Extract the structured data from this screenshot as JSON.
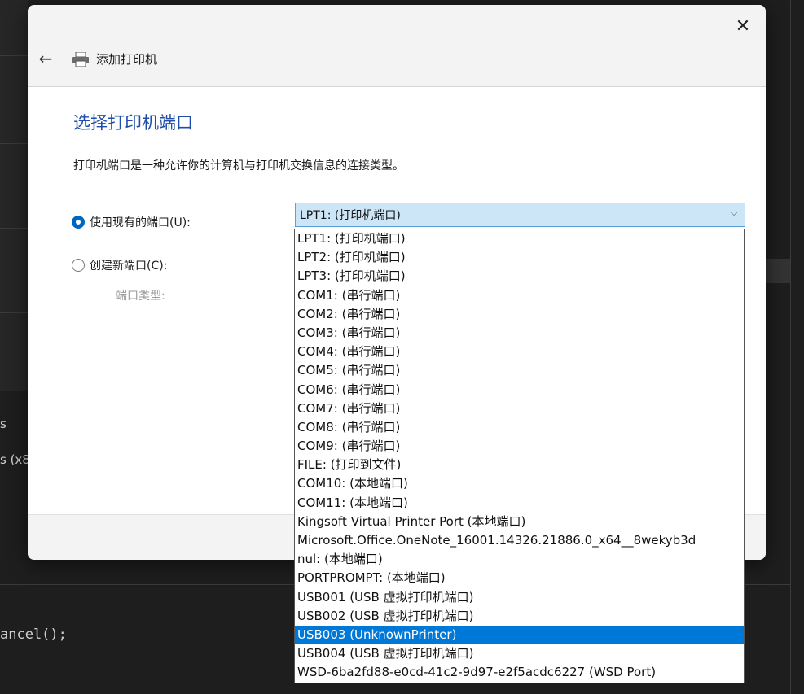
{
  "background": {
    "code_line": "ancel();",
    "side_text_1": "s",
    "side_text_2": "s (x8"
  },
  "dialog": {
    "close_glyph": "✕",
    "back_glyph": "←",
    "title": "添加打印机",
    "heading": "选择打印机端口",
    "description": "打印机端口是一种允许你的计算机与打印机交换信息的连接类型。",
    "use_existing_label": "使用现有的端口(U):",
    "create_new_label": "创建新端口(C):",
    "port_type_label": "端口类型:",
    "use_existing_selected": true
  },
  "port_combo": {
    "value": "LPT1: (打印机端口)",
    "chevron": "⌵",
    "selected_index": 20,
    "options": [
      "LPT1: (打印机端口)",
      "LPT2: (打印机端口)",
      "LPT3: (打印机端口)",
      "COM1: (串行端口)",
      "COM2: (串行端口)",
      "COM3: (串行端口)",
      "COM4: (串行端口)",
      "COM5: (串行端口)",
      "COM6: (串行端口)",
      "COM7: (串行端口)",
      "COM8: (串行端口)",
      "COM9: (串行端口)",
      "FILE: (打印到文件)",
      "COM10: (本地端口)",
      "COM11: (本地端口)",
      "Kingsoft Virtual Printer Port (本地端口)",
      "Microsoft.Office.OneNote_16001.14326.21886.0_x64__8wekyb3d",
      "nul: (本地端口)",
      "PORTPROMPT: (本地端口)",
      "USB001 (USB 虚拟打印机端口)",
      "USB002 (USB 虚拟打印机端口)",
      "USB003 (UnknownPrinter)",
      "USB004 (USB 虚拟打印机端口)",
      "WSD-6ba2fd88-e0cd-41c2-9d97-e2f5acdc6227 (WSD Port)"
    ]
  },
  "colors": {
    "accent": "#0067c0",
    "heading": "#1f4ea8",
    "selection": "#0078d7",
    "combo_fill": "#cde6f7"
  }
}
